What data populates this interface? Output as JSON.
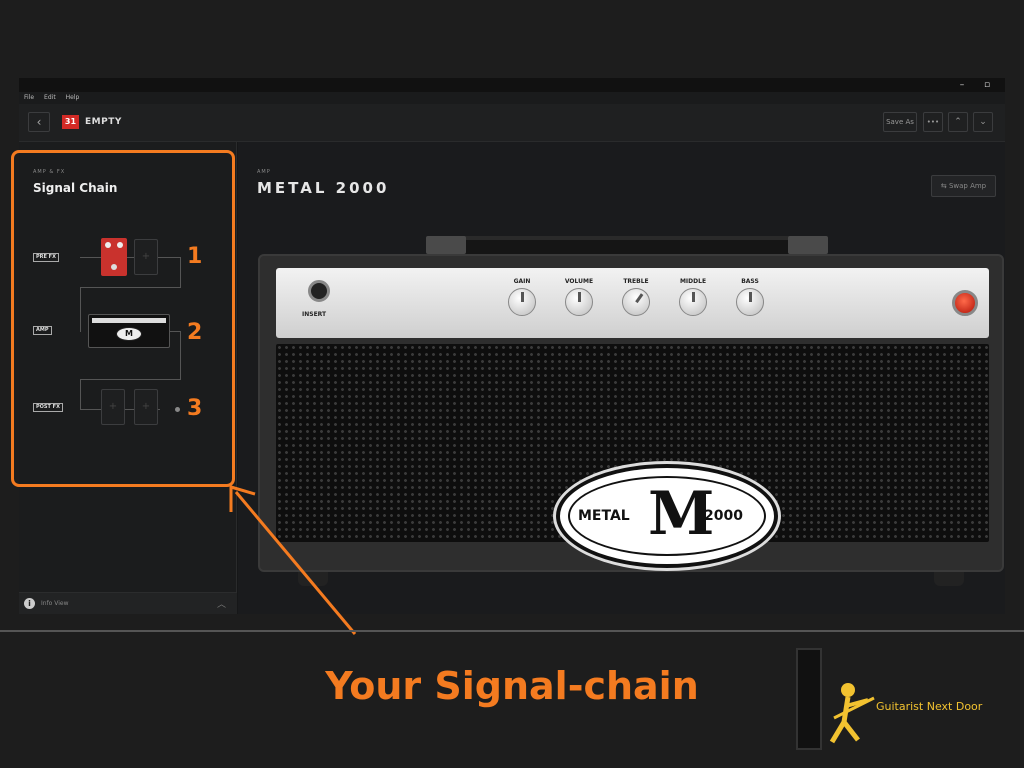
{
  "menu": [
    "File",
    "Edit",
    "Help"
  ],
  "window_controls": {
    "minimize": "–",
    "maximize": "▫",
    "close": "✕"
  },
  "header": {
    "back_icon": "‹",
    "preset_number": "31",
    "preset_name": "EMPTY",
    "save_as": "Save As",
    "more": "•••",
    "prev_icon": "⌃",
    "next_icon": "⌄"
  },
  "sidebar": {
    "kicker": "AMP & FX",
    "title": "Signal Chain",
    "rows": [
      "PRE FX",
      "AMP",
      "POST FX"
    ],
    "plus": "+",
    "info_label": "Info View",
    "info_icon": "i",
    "info_chevron": "︿"
  },
  "main": {
    "kicker": "AMP",
    "amp_name": "METAL 2000",
    "swap_label": "Swap Amp",
    "insert_label": "INSERT",
    "knobs": [
      "GAIN",
      "VOLUME",
      "TREBLE",
      "MIDDLE",
      "BASS"
    ],
    "logo_left": "METAL",
    "logo_mid": "M",
    "logo_right": "2000"
  },
  "annotations": {
    "n1": "1",
    "n2": "2",
    "n3": "3",
    "caption": "Your Signal-chain",
    "brand": "Guitarist Next Door"
  },
  "colors": {
    "accent": "#f47b20",
    "preset_badge": "#d32a26",
    "brand_yellow": "#f2c230"
  }
}
